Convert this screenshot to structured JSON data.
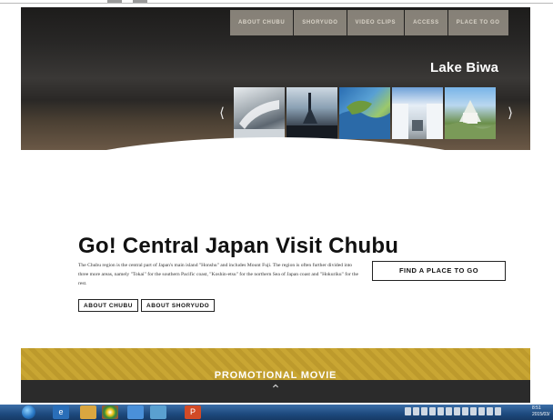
{
  "nav": {
    "items": [
      "ABOUT CHUBU",
      "SHORYUDO",
      "VIDEO CLIPS",
      "ACCESS",
      "PLACE TO GO"
    ]
  },
  "hero": {
    "title": "Lake Biwa",
    "prev_icon": "chevron-left-icon",
    "next_icon": "chevron-right-icon",
    "thumbnails": 5
  },
  "intro": {
    "headline": "Go! Central Japan Visit Chubu",
    "description": "The Chubu region is the central part of Japan's main island \"Honshu\" and includes Mount Fuji. The region is often further divided into three more areas, namely \"Tokai\" for the southern Pacific coast, \"Koshin-etsu\" for the northern Sea of Japan coast and \"Hokuriku\" for the rest.",
    "find_button": "FIND A PLACE TO GO",
    "about_chubu_button": "ABOUT CHUBU",
    "about_shoryudo_button": "ABOUT SHORYUDO"
  },
  "promo": {
    "title": "PROMOTIONAL MOVIE",
    "scroll_icon": "chevron-up-icon"
  },
  "taskbar": {
    "apps": [
      "internet-explorer-icon",
      "folder-icon",
      "chrome-icon",
      "app-icon",
      "app-icon",
      "powerpoint-icon"
    ],
    "clock_time": "8:51",
    "clock_date": "2015/03/"
  },
  "colors": {
    "promo_gold": "#c9a633",
    "nav_bg": "#afa89b",
    "taskbar_blue": "#1e4a7e"
  }
}
